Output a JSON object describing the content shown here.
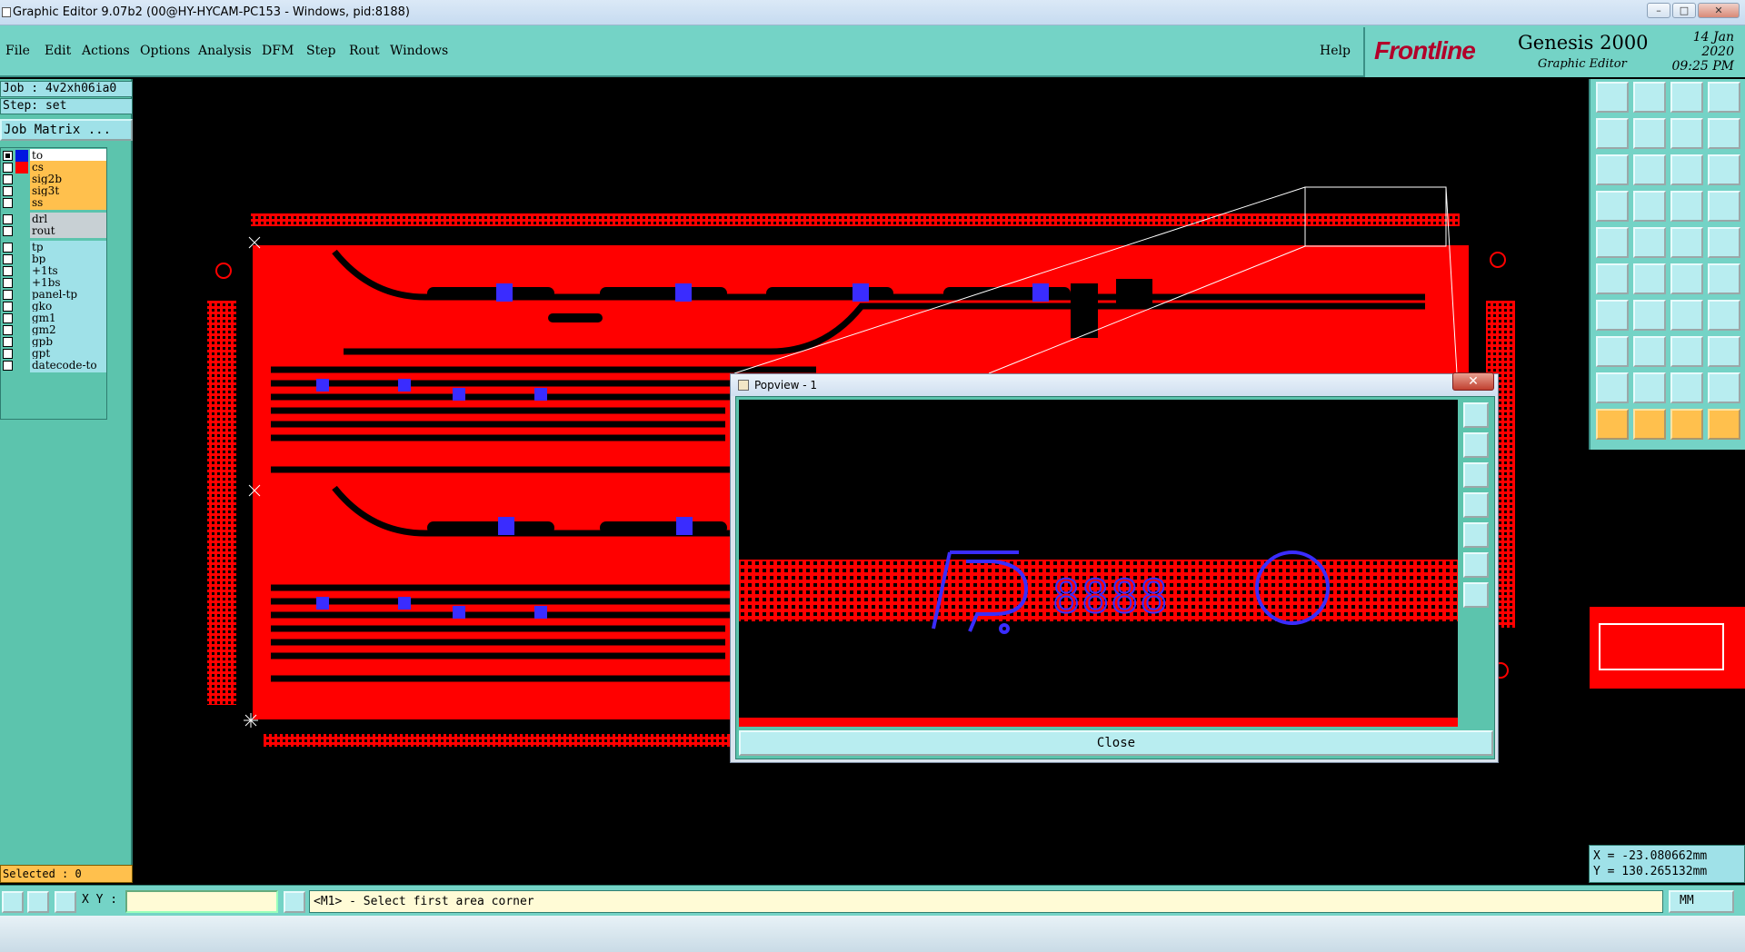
{
  "window": {
    "title": "Graphic Editor 9.07b2 (00@HY-HYCAM-PC153 - Windows, pid:8188)",
    "minimize": "–",
    "maximize": "□",
    "close": "✕"
  },
  "menu": {
    "items": [
      "File",
      "Edit",
      "Actions",
      "Options",
      "Analysis",
      "DFM",
      "Step",
      "Rout",
      "Windows"
    ],
    "help": "Help"
  },
  "brand": {
    "logo": "Frontline",
    "product": "Genesis 2000",
    "subtitle": "Graphic Editor",
    "date": "14 Jan 2020",
    "time": "09:25 PM"
  },
  "job": {
    "job_line": "Job : 4v2xh06ia0",
    "step_line": "Step: set",
    "matrix_button": "Job Matrix ..."
  },
  "layers": [
    {
      "name": "to",
      "color": "#ffffff",
      "swatch": "#0018e0",
      "checked": true
    },
    {
      "name": "cs",
      "color": "#ffc04d",
      "swatch": "#ff0000",
      "checked": false
    },
    {
      "name": "sig2b",
      "color": "#ffc04d",
      "swatch": "",
      "checked": false
    },
    {
      "name": "sig3t",
      "color": "#ffc04d",
      "swatch": "",
      "checked": false
    },
    {
      "name": "ss",
      "color": "#ffc04d",
      "swatch": "",
      "checked": false
    },
    {
      "name": "drl",
      "color": "#c8d0d4",
      "swatch": "",
      "checked": false
    },
    {
      "name": "rout",
      "color": "#c8d0d4",
      "swatch": "",
      "checked": false
    },
    {
      "name": "tp",
      "color": "#9fe1e8",
      "swatch": "",
      "checked": false
    },
    {
      "name": "bp",
      "color": "#9fe1e8",
      "swatch": "",
      "checked": false
    },
    {
      "name": "+1ts",
      "color": "#9fe1e8",
      "swatch": "",
      "checked": false
    },
    {
      "name": "+1bs",
      "color": "#9fe1e8",
      "swatch": "",
      "checked": false
    },
    {
      "name": "panel-tp",
      "color": "#9fe1e8",
      "swatch": "",
      "checked": false
    },
    {
      "name": "gko",
      "color": "#9fe1e8",
      "swatch": "",
      "checked": false
    },
    {
      "name": "gm1",
      "color": "#9fe1e8",
      "swatch": "",
      "checked": false
    },
    {
      "name": "gm2",
      "color": "#9fe1e8",
      "swatch": "",
      "checked": false
    },
    {
      "name": "gpb",
      "color": "#9fe1e8",
      "swatch": "",
      "checked": false
    },
    {
      "name": "gpt",
      "color": "#9fe1e8",
      "swatch": "",
      "checked": false
    },
    {
      "name": "datecode-to",
      "color": "#9fe1e8",
      "swatch": "",
      "checked": false
    }
  ],
  "selected": "Selected : 0",
  "popview": {
    "title": "Popview - 1",
    "close_label": "Close",
    "close_x": "✕",
    "digits": "8888"
  },
  "coords": {
    "x": "X = -23.080662mm",
    "y": "Y = 130.265132mm"
  },
  "status": {
    "xy_label": "X Y :",
    "xy_value": "",
    "message": "<M1> - Select first area corner",
    "units": "MM"
  },
  "colors": {
    "panel": "#74d3c6",
    "copper": "#ff0000",
    "highlight": "#ffc04d",
    "selection": "#3a2cff"
  }
}
